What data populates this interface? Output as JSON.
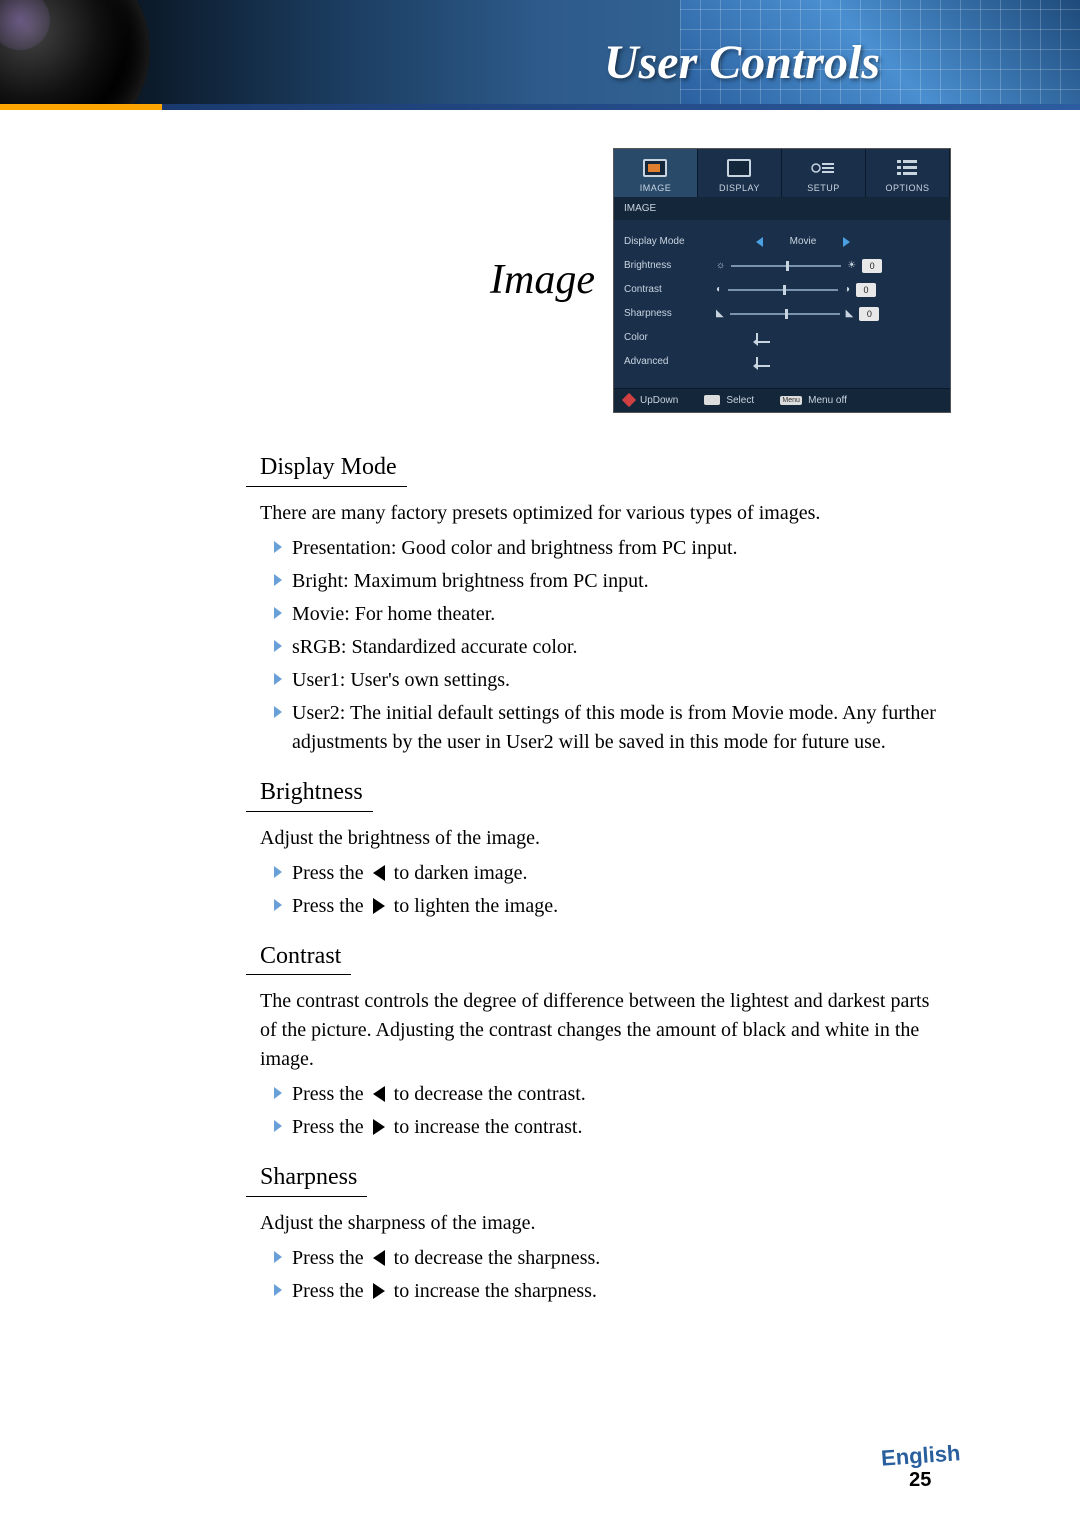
{
  "header": {
    "title": "User Controls"
  },
  "sectionTitle": "Image",
  "osd": {
    "tabs": [
      {
        "label": "IMAGE"
      },
      {
        "label": "DISPLAY"
      },
      {
        "label": "SETUP"
      },
      {
        "label": "OPTIONS"
      }
    ],
    "subhead": "IMAGE",
    "rows": {
      "displayMode": {
        "label": "Display Mode",
        "value": "Movie"
      },
      "brightness": {
        "label": "Brightness",
        "value": "0"
      },
      "contrast": {
        "label": "Contrast",
        "value": "0"
      },
      "sharpness": {
        "label": "Sharpness",
        "value": "0"
      },
      "color": {
        "label": "Color"
      },
      "advanced": {
        "label": "Advanced"
      }
    },
    "footer": {
      "updown": "UpDown",
      "select": "Select",
      "menuKey": "Menu",
      "menuoff": "Menu off"
    }
  },
  "sections": {
    "displayMode": {
      "heading": "Display Mode",
      "intro": "There are many factory presets optimized for various types of images.",
      "items": [
        "Presentation: Good color and brightness from PC input.",
        "Bright: Maximum brightness from PC input.",
        "Movie: For home theater.",
        "sRGB: Standardized accurate color.",
        "User1: User's own settings.",
        "User2: The initial default settings of this mode is from Movie mode. Any further adjustments by the user in User2 will be saved in this mode for future use."
      ]
    },
    "brightness": {
      "heading": "Brightness",
      "intro": "Adjust the brightness of the image.",
      "left": {
        "pre": " Press the ",
        "post": " to darken image."
      },
      "right": {
        "pre": " Press the ",
        "post": " to lighten the image."
      }
    },
    "contrast": {
      "heading": "Contrast",
      "intro": "The contrast controls the degree of difference between the lightest and darkest parts of the picture. Adjusting the contrast changes the amount of black and white in the image.",
      "left": {
        "pre": " Press the ",
        "post": " to decrease the contrast."
      },
      "right": {
        "pre": " Press the ",
        "post": " to increase the contrast."
      }
    },
    "sharpness": {
      "heading": "Sharpness",
      "intro": "Adjust the sharpness of the image.",
      "left": {
        "pre": " Press the ",
        "post": " to decrease the sharpness."
      },
      "right": {
        "pre": " Press the ",
        "post": " to increase the sharpness."
      }
    }
  },
  "footer": {
    "language": "English",
    "page": "25"
  }
}
